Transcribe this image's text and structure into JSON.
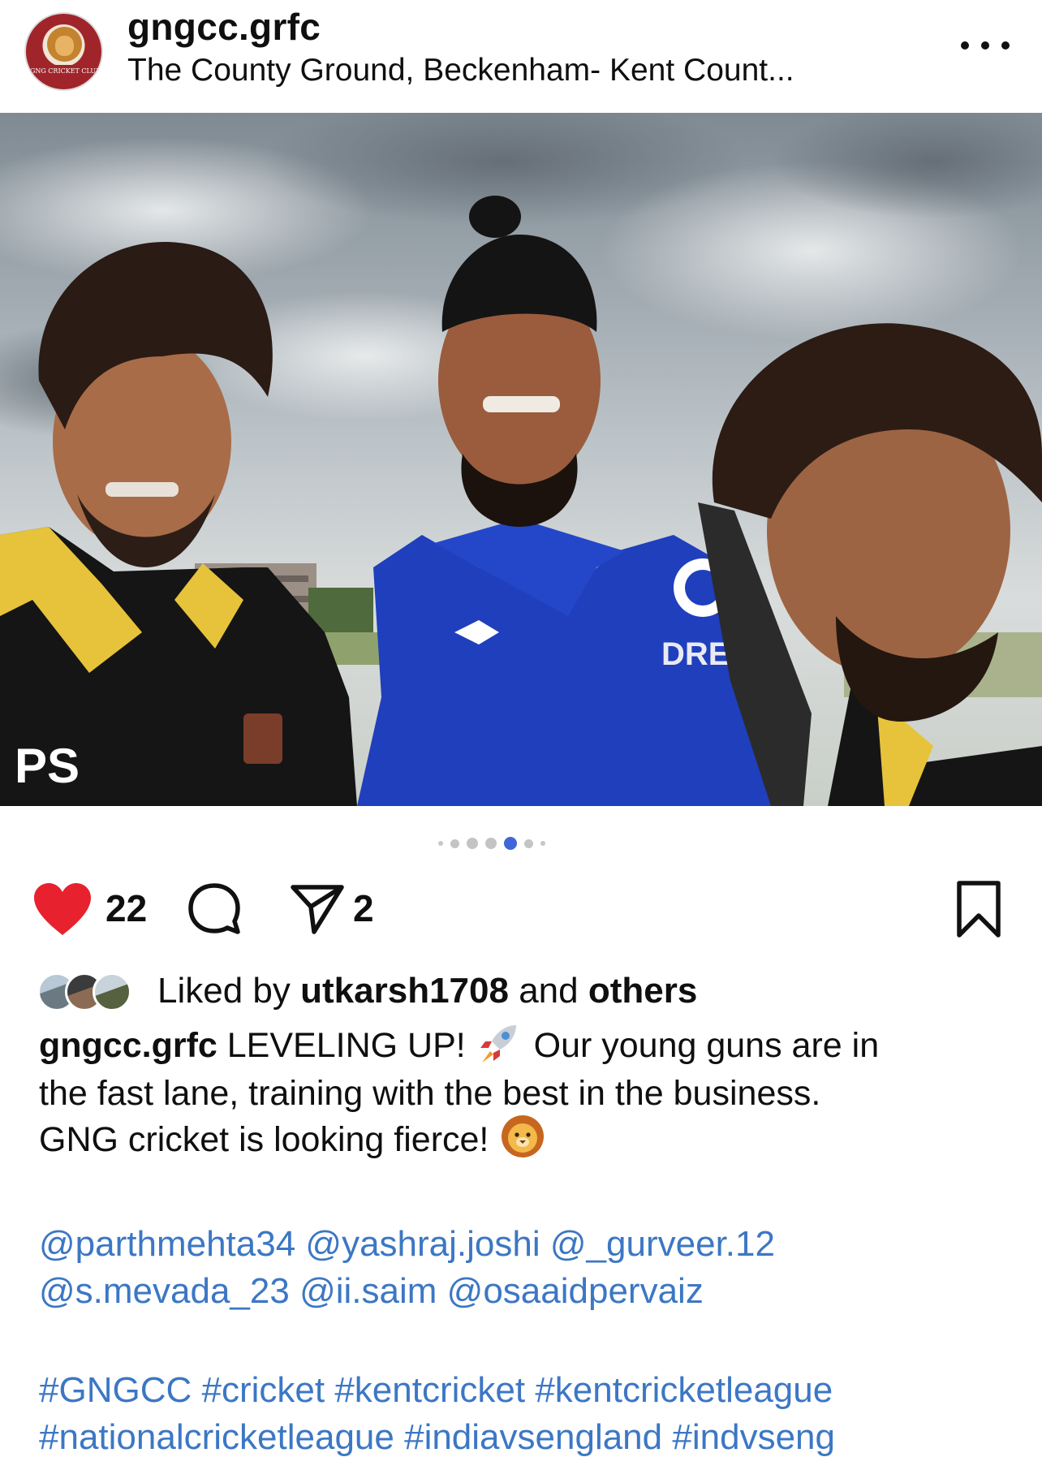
{
  "post": {
    "account_name": "gngcc.grfc",
    "location": "The County Ground, Beckenham- Kent Count...",
    "avatar_logo_text": "GNG CRICKET CLUB",
    "photo": {
      "shirt_logo_left": "PS",
      "shirt_text_center": "DREA"
    },
    "carousel": {
      "total_dots": 7,
      "active_index": 4
    },
    "actions": {
      "likes_count": "22",
      "shares_count": "2"
    },
    "liked_by": {
      "prefix": "Liked by",
      "user": "utkarsh1708",
      "and": "and",
      "others": "others"
    },
    "caption": {
      "author": "gngcc.grfc",
      "line1_text": "LEVELING UP!",
      "line1_after": "Our young guns are in",
      "line2": "the fast lane, training with the best in the business.",
      "line3": "GNG cricket is looking fierce!"
    },
    "mentions": [
      "@parthmehta34",
      "@yashraj.joshi",
      "@_gurveer.12",
      "@s.mevada_23",
      "@ii.saim",
      "@osaaidpervaiz"
    ],
    "hashtags": [
      "#GNGCC",
      "#cricket",
      "#kentcricket",
      "#kentcricketleague",
      "#nationalcricketleague",
      "#indiavsengland",
      "#indvseng"
    ],
    "colors": {
      "heart": "#e8212e",
      "link": "#3c77c4",
      "active_dot": "#3f67d9"
    },
    "icons": [
      "heart-icon",
      "comment-icon",
      "share-icon",
      "bookmark-icon",
      "more-icon",
      "rocket-icon",
      "lion-icon"
    ]
  }
}
